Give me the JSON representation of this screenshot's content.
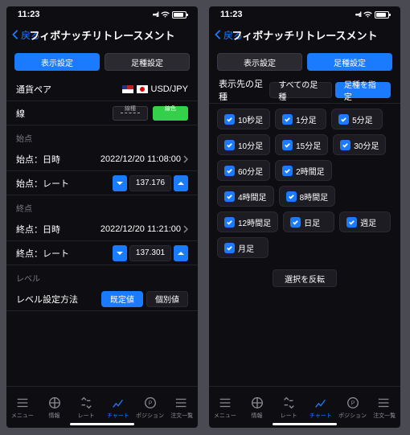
{
  "status_time": "11:23",
  "back_label": "戻る",
  "screen_title": "フィボナッチリトレースメント",
  "tabs_seg": {
    "display": "表示設定",
    "legtype": "足種設定"
  },
  "left": {
    "pair_label": "通貨ペア",
    "pair_value": "USD/JPY",
    "line_label": "線",
    "line_style_label": "線種",
    "line_color_label": "線色",
    "start_head": "始点",
    "end_head": "終点",
    "dt_label_start": "始点：日時",
    "dt_value_start": "2022/12/20 11:08:00",
    "rate_label_start": "始点：レート",
    "rate_value_start": "137.176",
    "dt_label_end": "終点：日時",
    "dt_value_end": "2022/12/20 11:21:00",
    "rate_label_end": "終点：レート",
    "rate_value_end": "137.301",
    "level_head": "レベル",
    "level_method_label": "レベル設定方法",
    "level_preset": "既定値",
    "level_custom": "個別値"
  },
  "right": {
    "target_label": "表示先の足種",
    "all_label": "すべての足種",
    "specify_label": "足種を指定",
    "chips": [
      "10秒足",
      "1分足",
      "5分足",
      "10分足",
      "15分足",
      "30分足",
      "60分足",
      "2時間足",
      "4時間足",
      "8時間足",
      "12時間足",
      "日足",
      "週足",
      "月足"
    ],
    "invert_label": "選択を反転"
  },
  "footer": {
    "menu": "メニュー",
    "info": "情報",
    "rate": "レート",
    "chart": "チャート",
    "position": "ポジション",
    "orders": "注文一覧"
  }
}
